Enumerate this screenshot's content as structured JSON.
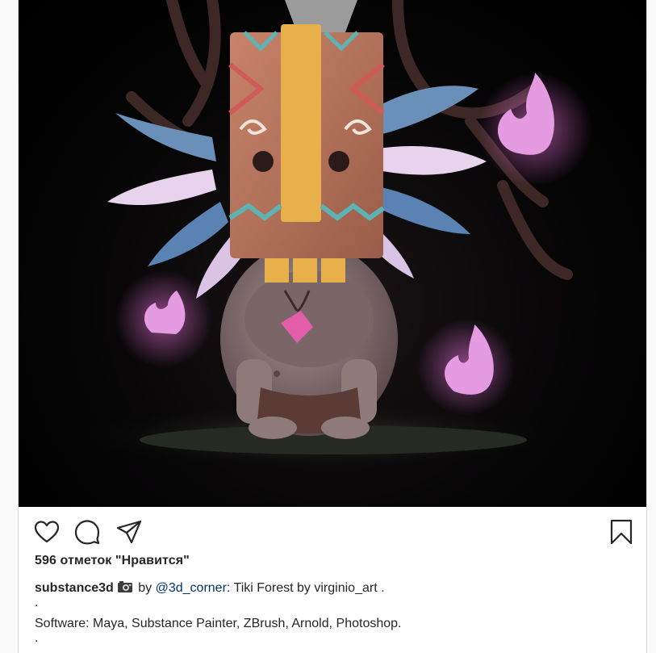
{
  "post": {
    "likes_text": "596 отметок \"Нравится\"",
    "caption": {
      "username": "substance3d",
      "camera_icon": "camera-emoji-icon",
      "by_text": " by ",
      "mention": "@3d_corner",
      "title_text": ": Tiki Forest by virginio_art .",
      "dot1": ".",
      "software_line": "Software: Maya, Substance Painter, ZBrush, Arnold, Photoshop.",
      "dot2": "."
    },
    "actions": {
      "like_icon": "heart-icon",
      "comment_icon": "comment-icon",
      "share_icon": "share-icon",
      "save_icon": "bookmark-icon"
    }
  },
  "colors": {
    "text": "#262626",
    "mention": "#00376b",
    "border": "#dbdbdb",
    "page_bg": "#fafafa"
  }
}
